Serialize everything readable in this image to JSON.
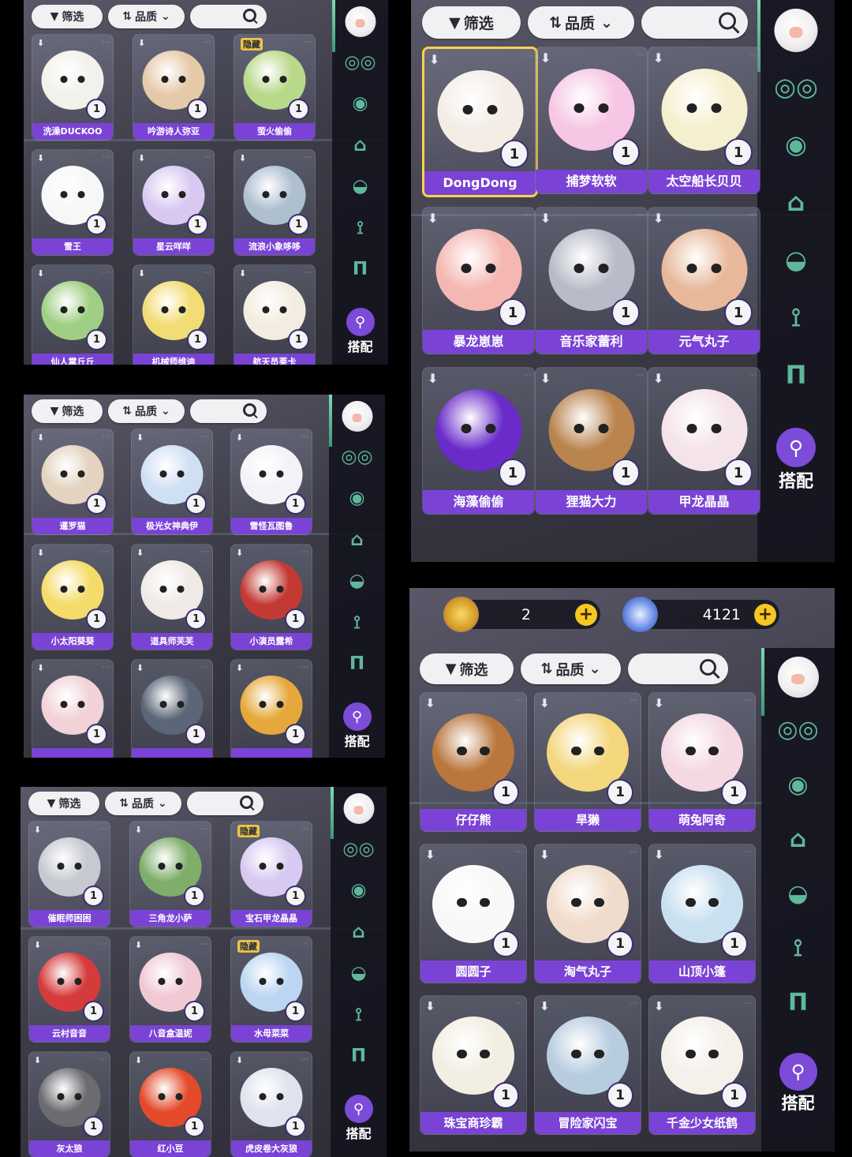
{
  "colors": {
    "name_band": "#7a43d6",
    "accent": "#5fb89a",
    "selected": "#ffd24a",
    "hidden_tag": "#e9c44a",
    "plus": "#f6c623"
  },
  "filter_label": "筛选",
  "sort_label": "品质",
  "dress_label": "搭配",
  "hidden_tag_label": "隐藏",
  "sidebar_icons": [
    "glasses-icon",
    "mask-icon",
    "hat-icon",
    "cap-icon",
    "shirt-icon",
    "pants-icon"
  ],
  "currency": {
    "coin_value": "2",
    "gem_value": "4121"
  },
  "panels": [
    {
      "id": "p1",
      "items": [
        {
          "name": "洗澡DUCKOO",
          "count": "1",
          "color": "#f3f1ec"
        },
        {
          "name": "吟游诗人弥亚",
          "count": "1",
          "color": "#e6c9a9"
        },
        {
          "name": "萤火偷偷",
          "count": "1",
          "color": "#b9d98a",
          "hidden": true
        },
        {
          "name": "雪王",
          "count": "1",
          "color": "#f7f7f7"
        },
        {
          "name": "星云咩咩",
          "count": "1",
          "color": "#d9c9f2"
        },
        {
          "name": "流浪小象哆哆",
          "count": "1",
          "color": "#aebfd0"
        },
        {
          "name": "仙人掌丘丘",
          "count": "1",
          "color": "#9fcf84"
        },
        {
          "name": "机械师维迪",
          "count": "1",
          "color": "#f2dc74"
        },
        {
          "name": "航天员莱卡",
          "count": "1",
          "color": "#f3ece0"
        }
      ]
    },
    {
      "id": "p2",
      "items": [
        {
          "name": "DongDong",
          "count": "1",
          "color": "#f4ede6",
          "selected": true
        },
        {
          "name": "捕梦软软",
          "count": "1",
          "color": "#f6c6e4"
        },
        {
          "name": "太空船长贝贝",
          "count": "1",
          "color": "#f6efcf"
        },
        {
          "name": "暴龙崽崽",
          "count": "1",
          "color": "#f4b7b2"
        },
        {
          "name": "音乐家蕾利",
          "count": "1",
          "color": "#b9bcc8"
        },
        {
          "name": "元气丸子",
          "count": "1",
          "color": "#e8b89a"
        },
        {
          "name": "海藻偷偷",
          "count": "1",
          "color": "#6a2bc9"
        },
        {
          "name": "狸猫大力",
          "count": "1",
          "color": "#b9844e"
        },
        {
          "name": "甲龙晶晶",
          "count": "1",
          "color": "#f4e3e9"
        }
      ]
    },
    {
      "id": "p3",
      "items": [
        {
          "name": "暹罗猫",
          "count": "1",
          "color": "#e3d3bf"
        },
        {
          "name": "极光女神典伊",
          "count": "1",
          "color": "#cfe0f4"
        },
        {
          "name": "雪怪瓦图鲁",
          "count": "1",
          "color": "#f4f2f7"
        },
        {
          "name": "小太阳葵葵",
          "count": "1",
          "color": "#f5dc6a"
        },
        {
          "name": "道具师芙芙",
          "count": "1",
          "color": "#efeae6"
        },
        {
          "name": "小演员露希",
          "count": "1",
          "color": "#c23a33"
        },
        {
          "name": "",
          "count": "1",
          "color": "#f1d2d8"
        },
        {
          "name": "",
          "count": "1",
          "color": "#5b6678"
        },
        {
          "name": "",
          "count": "1",
          "color": "#e6a83b"
        }
      ]
    },
    {
      "id": "p4",
      "items": [
        {
          "name": "仔仔熊",
          "count": "1",
          "color": "#b9763d"
        },
        {
          "name": "旱獭",
          "count": "1",
          "color": "#f4d67c"
        },
        {
          "name": "萌兔阿奇",
          "count": "1",
          "color": "#f4d8e2"
        },
        {
          "name": "圆圆子",
          "count": "1",
          "color": "#f8f8f8"
        },
        {
          "name": "淘气丸子",
          "count": "1",
          "color": "#f0dccc"
        },
        {
          "name": "山顶小篷",
          "count": "1",
          "color": "#c9e0f0"
        },
        {
          "name": "珠宝商珍霸",
          "count": "1",
          "color": "#f3eee2"
        },
        {
          "name": "冒险家闪宝",
          "count": "1",
          "color": "#b8cce0"
        },
        {
          "name": "千金少女纸鹤",
          "count": "1",
          "color": "#f4f0ea"
        }
      ]
    },
    {
      "id": "p5",
      "items": [
        {
          "name": "催眠师困困",
          "count": "1",
          "color": "#c7c9d1"
        },
        {
          "name": "三角龙小萨",
          "count": "1",
          "color": "#7fae6a"
        },
        {
          "name": "宝石甲龙晶晶",
          "count": "1",
          "color": "#d8c9f2",
          "hidden": true
        },
        {
          "name": "云村音音",
          "count": "1",
          "color": "#d63b3b"
        },
        {
          "name": "八音盒温妮",
          "count": "1",
          "color": "#f0c9d4"
        },
        {
          "name": "水母菜菜",
          "count": "1",
          "color": "#bcd6f2",
          "hidden": true
        },
        {
          "name": "灰太狼",
          "count": "1",
          "color": "#6b6b70"
        },
        {
          "name": "红小豆",
          "count": "1",
          "color": "#e44a2a"
        },
        {
          "name": "虎皮卷大灰狼",
          "count": "1",
          "color": "#dfe3ee"
        }
      ]
    }
  ]
}
